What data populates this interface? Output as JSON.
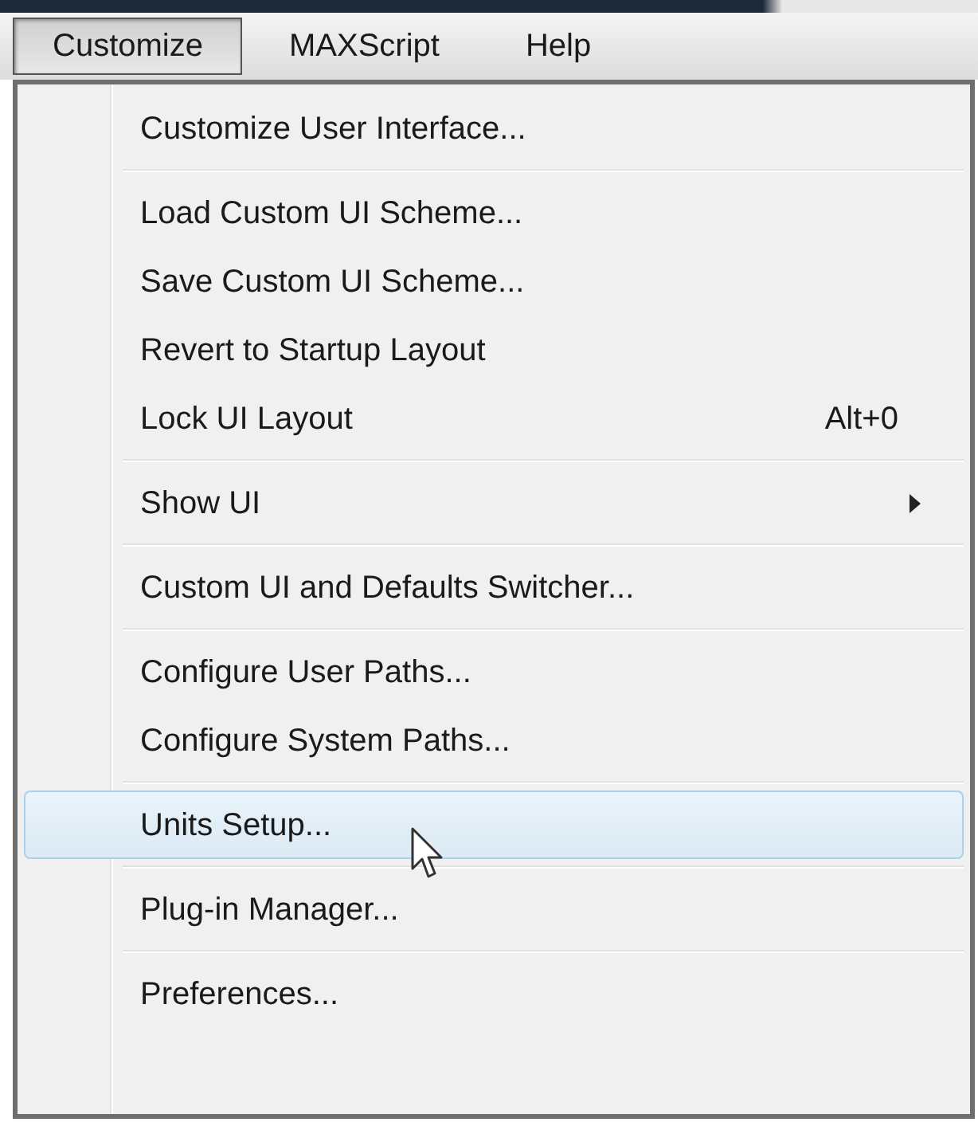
{
  "menubar": [
    {
      "label": "Customize",
      "selected": true
    },
    {
      "label": "MAXScript",
      "selected": false
    },
    {
      "label": "Help",
      "selected": false
    }
  ],
  "menu": [
    {
      "kind": "item",
      "label": "Customize User Interface...",
      "selected": false
    },
    {
      "kind": "separator"
    },
    {
      "kind": "item",
      "label": "Load Custom UI Scheme...",
      "selected": false
    },
    {
      "kind": "item",
      "label": "Save Custom UI Scheme...",
      "selected": false
    },
    {
      "kind": "item",
      "label": "Revert to Startup Layout",
      "selected": false
    },
    {
      "kind": "item",
      "label": "Lock UI Layout",
      "shortcut": "Alt+0",
      "selected": false
    },
    {
      "kind": "separator"
    },
    {
      "kind": "item",
      "label": "Show UI",
      "submenu": true,
      "selected": false
    },
    {
      "kind": "separator"
    },
    {
      "kind": "item",
      "label": "Custom UI and Defaults Switcher...",
      "selected": false
    },
    {
      "kind": "separator"
    },
    {
      "kind": "item",
      "label": "Configure User Paths...",
      "selected": false
    },
    {
      "kind": "item",
      "label": "Configure System Paths...",
      "selected": false
    },
    {
      "kind": "separator"
    },
    {
      "kind": "item",
      "label": "Units Setup...",
      "selected": true
    },
    {
      "kind": "separator"
    },
    {
      "kind": "item",
      "label": "Plug-in Manager...",
      "selected": false
    },
    {
      "kind": "separator"
    },
    {
      "kind": "item",
      "label": "Preferences...",
      "selected": false
    }
  ]
}
